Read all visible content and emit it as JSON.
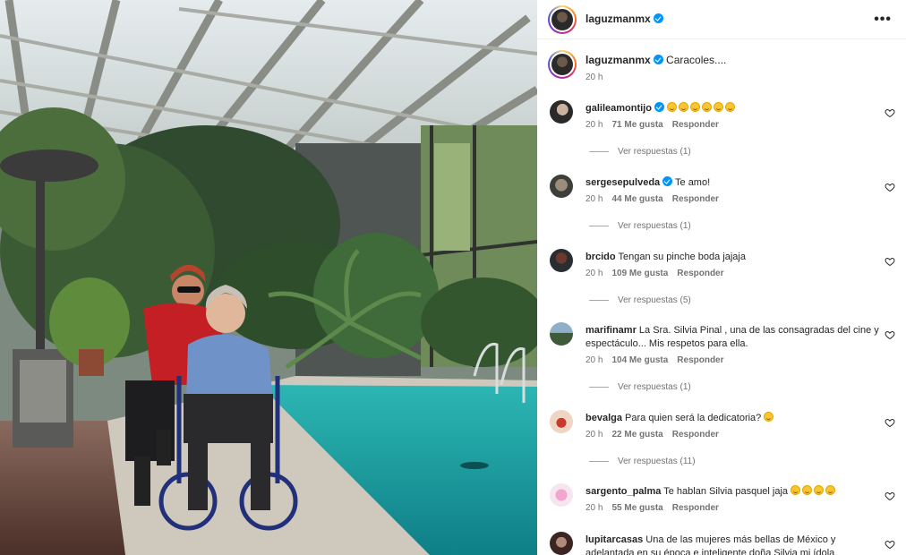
{
  "post": {
    "author": "laguzmanmx",
    "more_icon": "more-horizontal-icon",
    "caption": "Caracoles....",
    "caption_time": "20 h"
  },
  "comments": [
    {
      "user": "galileamontijo",
      "verified": true,
      "text": "",
      "emoji_count": 6,
      "time": "20 h",
      "likes": "71 Me gusta",
      "reply": "Responder",
      "view_replies": "Ver respuestas (1)"
    },
    {
      "user": "sergesepulveda",
      "verified": true,
      "text": "Te amo!",
      "time": "20 h",
      "likes": "44 Me gusta",
      "reply": "Responder",
      "view_replies": "Ver respuestas (1)"
    },
    {
      "user": "brcido",
      "verified": false,
      "text": "Tengan su pinche boda jajaja",
      "time": "20 h",
      "likes": "109 Me gusta",
      "reply": "Responder",
      "view_replies": "Ver respuestas (5)"
    },
    {
      "user": "marifinamr",
      "verified": false,
      "text": "La Sra. Silvia Pinal , una de las consagradas del cine y espectáculo... Mis respetos para ella.",
      "time": "20 h",
      "likes": "104 Me gusta",
      "reply": "Responder",
      "view_replies": "Ver respuestas (1)"
    },
    {
      "user": "bevalga",
      "verified": false,
      "text": "Para quien será la dedicatoria?",
      "emoji_count": 1,
      "time": "20 h",
      "likes": "22 Me gusta",
      "reply": "Responder",
      "view_replies": "Ver respuestas (11)"
    },
    {
      "user": "sargento_palma",
      "verified": false,
      "text": "Te hablan Silvia pasquel jaja",
      "emoji_count": 4,
      "time": "20 h",
      "likes": "55 Me gusta",
      "reply": "Responder"
    },
    {
      "user": "lupitarcasas",
      "verified": false,
      "text": "Una de las mujeres más bellas de México y adelantada en su época e inteligente doña Silvia mi ídola"
    }
  ],
  "colors": {
    "verified": "#0095f6",
    "secondary_text": "#737373",
    "pool": "#1aa3a8"
  }
}
